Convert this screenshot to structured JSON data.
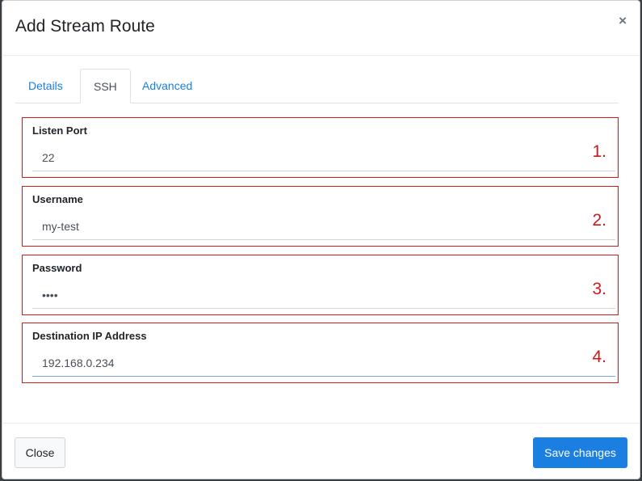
{
  "modal": {
    "title": "Add Stream Route",
    "close_symbol": "×"
  },
  "tabs": [
    {
      "label": "Details",
      "active": false
    },
    {
      "label": "SSH",
      "active": true
    },
    {
      "label": "Advanced",
      "active": false
    }
  ],
  "fields": [
    {
      "label": "Listen Port",
      "value": "22",
      "step": "1."
    },
    {
      "label": "Username",
      "value": "my-test",
      "step": "2."
    },
    {
      "label": "Password",
      "value": "••••",
      "step": "3."
    },
    {
      "label": "Destination IP Address",
      "value": "192.168.0.234",
      "step": "4."
    }
  ],
  "footer": {
    "close_label": "Close",
    "save_label": "Save changes"
  },
  "colors": {
    "accent": "#1a7fe0",
    "annotation": "#d11a1a"
  }
}
